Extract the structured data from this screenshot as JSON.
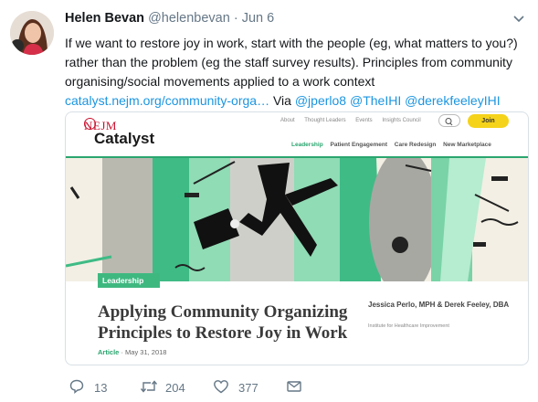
{
  "tweet": {
    "author_name": "Helen Bevan",
    "author_handle": "@helenbevan",
    "separator": "·",
    "date": "Jun 6",
    "text_main": "If we want to restore joy in work, start with the people (eg, what matters to you?) rather than the problem (eg the staff survey results). Principles from community organising/social movements applied to a work context",
    "link_text": "catalyst.nejm.org/community-orga…",
    "via_label": "Via",
    "mentions": [
      "@jperlo8",
      "@TheIHI",
      "@derekfeeleyIHI"
    ]
  },
  "card": {
    "brand_top": "NEJM",
    "brand_main": "Catalyst",
    "topnav": [
      "About",
      "Thought Leaders",
      "Events",
      "Insights Council"
    ],
    "join_label": "Join",
    "mainnav": [
      "Leadership",
      "Patient Engagement",
      "Care Redesign",
      "New Marketplace"
    ],
    "tag": "Leadership",
    "title": "Applying Community Organizing Principles to Restore Joy in Work",
    "authors": "Jessica Perlo, MPH & Derek Feeley, DBA",
    "institute": "Institute for Healthcare Improvement",
    "article_kind": "Article",
    "article_date": "· May 31, 2018",
    "accent_color": "#2aa56e",
    "join_color": "#f5d31a"
  },
  "actions": {
    "reply_count": "13",
    "retweet_count": "204",
    "like_count": "377",
    "icons": [
      "reply-icon",
      "retweet-icon",
      "like-icon",
      "direct-message-icon"
    ]
  }
}
